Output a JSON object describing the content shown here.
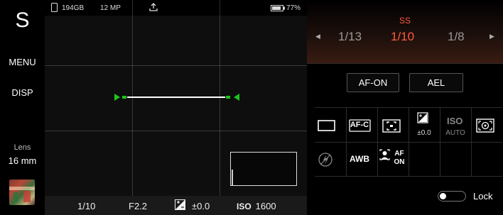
{
  "left_rail": {
    "mode": "S",
    "menu_label": "MENU",
    "disp_label": "DISP",
    "lens_label": "Lens",
    "lens_value": "16 mm"
  },
  "status_bar": {
    "storage": "194GB",
    "megapixels": "12 MP",
    "battery": "77%",
    "icons": [
      "sd-card-icon",
      "upload-icon",
      "battery-icon"
    ]
  },
  "viewfinder": {
    "grid": "3x3",
    "level_indicator": "level"
  },
  "bottom_bar": {
    "shutter": "1/10",
    "aperture": "F2.2",
    "exposure_comp": "±0.0",
    "iso_label": "ISO",
    "iso_value": "1600"
  },
  "ss_dial": {
    "title": "SS",
    "prev": "1/13",
    "current": "1/10",
    "next": "1/8",
    "accent_color": "#ff5a3c"
  },
  "buttons": {
    "af_on": "AF-ON",
    "ael": "AEL"
  },
  "function_grid": {
    "row1": {
      "aspect": "aspect-ratio-icon",
      "focus_mode": "AF-C",
      "focus_area": "focus-area-icon",
      "exposure_comp_value": "±0.0",
      "iso_value": "AUTO",
      "metering": "metering-icon"
    },
    "row2": {
      "flash": "flash-off-icon",
      "white_balance": "AWB",
      "face_af": "AF",
      "face_af_sub": "ON"
    }
  },
  "lock": {
    "label": "Lock",
    "enabled": false
  }
}
